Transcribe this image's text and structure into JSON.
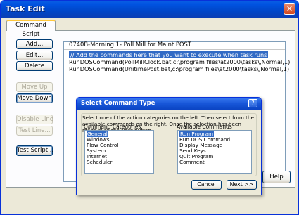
{
  "window": {
    "title": "Task Edit",
    "close_glyph": "✕"
  },
  "tab": {
    "label": "Command Script"
  },
  "buttons": {
    "add": "Add...",
    "edit": "Edit...",
    "delete": "Delete",
    "move_up": "Move Up",
    "move_down": "Move Down",
    "disable_line": "Disable Line",
    "test_line": "Test Line...",
    "test_script": "Test Script...",
    "help": "Help"
  },
  "script": {
    "header": "0740B-Morning 1- Poll Mill for Maint  POST",
    "lines": [
      "// Add the commands here that you want to execute when task runs",
      "RunDOSCommand(PollMillClock.bat,c:\\program files\\at2000\\tasks\\,Normal,1)",
      "RunDOSCommand(UnitimePost.bat,c:\\program files\\at2000\\tasks\\,Normal,1)"
    ]
  },
  "dialog": {
    "title": "Select Command Type",
    "help_glyph": "?",
    "description": "Select one of the action categories on the left. Then select from the available commands on the right. Once the selection has been made click the Next button.",
    "categories_label": "Command Categories:",
    "commands_label": "Available Commands",
    "categories": [
      "General",
      "Windows",
      "Flow Control",
      "System",
      "Internet",
      "Scheduler"
    ],
    "commands": [
      "Run Program",
      "Run DOS Command",
      "Display Message",
      "Send Keys",
      "Quit Program",
      "Comment"
    ],
    "cancel": "Cancel",
    "next": "Next >>"
  }
}
